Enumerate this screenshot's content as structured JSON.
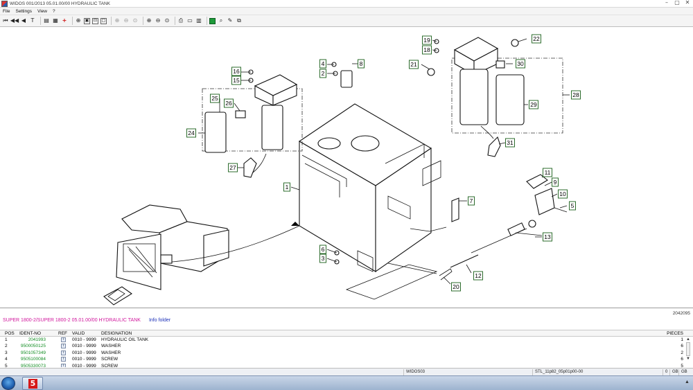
{
  "window": {
    "title": "WIDOS 001/2013   05.01.00/00 HYDRAULIC TANK",
    "controls": [
      "minimize",
      "maximize",
      "close"
    ]
  },
  "menu": {
    "items": [
      "File",
      "Settings",
      "View",
      "?"
    ]
  },
  "toolbar": {
    "buttons": [
      {
        "icon": "first-page-icon",
        "glyph": "⏮"
      },
      {
        "icon": "previous-fast-icon",
        "glyph": "◀◀"
      },
      {
        "icon": "previous-icon",
        "glyph": "◀"
      },
      {
        "icon": "toggle-text-icon",
        "glyph": "T"
      },
      {
        "icon": "copy-icon",
        "glyph": "▤"
      },
      {
        "icon": "list-icon",
        "glyph": "▦"
      },
      {
        "icon": "add-icon",
        "glyph": "+"
      },
      {
        "icon": "zoom-in-icon",
        "glyph": "⊕"
      },
      {
        "icon": "fit-page-icon",
        "glyph": "▣"
      },
      {
        "icon": "zoom-window-icon",
        "glyph": "⊡"
      },
      {
        "icon": "blank-icon",
        "glyph": "□"
      },
      {
        "icon": "zoom-in-disabled-icon",
        "glyph": "⊕"
      },
      {
        "icon": "zoom-out-disabled-icon",
        "glyph": "⊖"
      },
      {
        "icon": "zoom-reset-disabled-icon",
        "glyph": "⊙"
      },
      {
        "icon": "zoom-plus-icon",
        "glyph": "⊕"
      },
      {
        "icon": "zoom-minus-icon",
        "glyph": "⊖"
      },
      {
        "icon": "zoom-area-icon",
        "glyph": "⊙"
      },
      {
        "icon": "print-icon",
        "glyph": "⎙"
      },
      {
        "icon": "printer-icon",
        "glyph": "▭"
      },
      {
        "icon": "export-icon",
        "glyph": "▥"
      },
      {
        "icon": "green-flag-icon",
        "glyph": ""
      },
      {
        "icon": "attachment-icon",
        "glyph": "⌕"
      },
      {
        "icon": "edit-icon",
        "glyph": "✎"
      },
      {
        "icon": "stamp-icon",
        "glyph": "⧉"
      }
    ]
  },
  "drawing": {
    "callouts": [
      {
        "n": "1"
      },
      {
        "n": "2"
      },
      {
        "n": "3"
      },
      {
        "n": "4"
      },
      {
        "n": "5"
      },
      {
        "n": "6"
      },
      {
        "n": "7"
      },
      {
        "n": "8"
      },
      {
        "n": "9"
      },
      {
        "n": "10"
      },
      {
        "n": "11"
      },
      {
        "n": "12"
      },
      {
        "n": "13"
      },
      {
        "n": "15"
      },
      {
        "n": "16"
      },
      {
        "n": "18"
      },
      {
        "n": "19"
      },
      {
        "n": "20"
      },
      {
        "n": "21"
      },
      {
        "n": "22"
      },
      {
        "n": "24"
      },
      {
        "n": "25"
      },
      {
        "n": "26"
      },
      {
        "n": "27"
      },
      {
        "n": "28"
      },
      {
        "n": "29"
      },
      {
        "n": "30"
      },
      {
        "n": "31"
      }
    ]
  },
  "doc_number": "2042095",
  "info": {
    "title": "SUPER 1800-2/SUPER 1800-2  05.01.00/00 HYDRAULIC TANK",
    "folder_link": "Info folder"
  },
  "parts_table": {
    "columns": {
      "pos": "POS",
      "ident": "IDENT-NO",
      "ref": "REF",
      "valid": "VALID",
      "designation": "DESIGNATION",
      "pieces": "PIECES"
    },
    "rows": [
      {
        "pos": "1",
        "ident": "2041993",
        "valid": "0010 - 9999",
        "designation": "HYDRAULIC OIL TANK",
        "pieces": "1"
      },
      {
        "pos": "2",
        "ident": "9500050125",
        "valid": "0010 - 9999",
        "designation": "WASHER",
        "pieces": "6"
      },
      {
        "pos": "3",
        "ident": "9501057349",
        "valid": "0010 - 9999",
        "designation": "WASHER",
        "pieces": "2"
      },
      {
        "pos": "4",
        "ident": "9505100084",
        "valid": "0010 - 9999",
        "designation": "SCREW",
        "pieces": "6"
      },
      {
        "pos": "5",
        "ident": "9505330073",
        "valid": "0010 - 9999",
        "designation": "SCREW",
        "pieces": "5"
      }
    ],
    "ref_glyph": "i"
  },
  "statusbar": {
    "app": "WIDOS03",
    "file": "STL_11p82_05p01p00-00",
    "count": "0",
    "lang1": "GB",
    "lang2": "GB"
  },
  "taskbar": {
    "app_logo": "5"
  }
}
